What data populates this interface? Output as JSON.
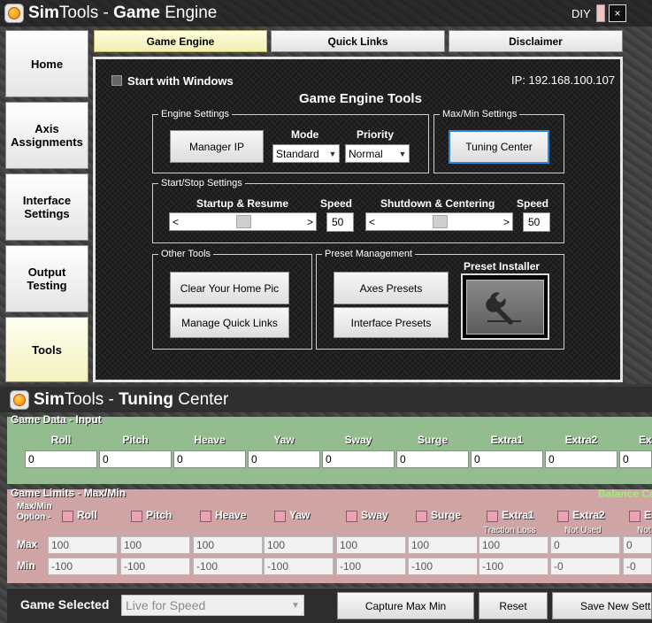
{
  "top_window": {
    "title_brand": "Sim",
    "title_brand_rest": "Tools - ",
    "title_bold": "Game",
    "title_rest": " Engine",
    "diy_label": "DIY",
    "close_glyph": "×",
    "logo_icon": "simtools-logo-icon",
    "sidebar": [
      {
        "label": "Home",
        "active": false
      },
      {
        "label": "Axis\nAssignments",
        "active": false
      },
      {
        "label": "Interface\nSettings",
        "active": false
      },
      {
        "label": "Output\nTesting",
        "active": false
      },
      {
        "label": "Tools",
        "active": true
      }
    ],
    "tabs": [
      {
        "label": "Game Engine",
        "active": true
      },
      {
        "label": "Quick Links",
        "active": false
      },
      {
        "label": "Disclaimer",
        "active": false
      }
    ],
    "tools": {
      "start_with_windows": "Start with Windows",
      "ip_label": "IP: 192.168.100.107",
      "heading": "Game Engine Tools",
      "engine_settings": {
        "title": "Engine Settings",
        "manager_ip_button": "Manager IP",
        "mode_label": "Mode",
        "mode_value": "Standard",
        "priority_label": "Priority",
        "priority_value": "Normal"
      },
      "maxmin_settings": {
        "title": "Max/Min Settings",
        "tuning_center_button": "Tuning Center"
      },
      "startstop_settings": {
        "title": "Start/Stop Settings",
        "startup_label": "Startup & Resume",
        "speed_label": "Speed",
        "startup_speed": "50",
        "shutdown_label": "Shutdown & Centering",
        "shutdown_speed": "50",
        "scroll_left": "<",
        "scroll_right": ">"
      },
      "other_tools": {
        "title": "Other Tools",
        "clear_home_pic": "Clear Your Home Pic",
        "manage_quick_links": "Manage Quick Links"
      },
      "preset_management": {
        "title": "Preset Management",
        "axes_presets": "Axes Presets",
        "interface_presets": "Interface Presets",
        "preset_installer_label": "Preset Installer",
        "preset_installer_icon": "wrench-icon"
      }
    }
  },
  "bottom_window": {
    "title_brand": "Sim",
    "title_brand_rest": "Tools - ",
    "title_bold": "Tuning",
    "title_rest": " Center",
    "game_data": {
      "title": "Game Data - Input",
      "columns": [
        "Roll",
        "Pitch",
        "Heave",
        "Yaw",
        "Sway",
        "Surge",
        "Extra1",
        "Extra2",
        "Ex"
      ],
      "values": [
        "0",
        "0",
        "0",
        "0",
        "0",
        "0",
        "0",
        "0",
        "0"
      ]
    },
    "game_limits": {
      "title": "Game Limits - Max/Min",
      "balance_label": "Balance Ca",
      "option_label_line1": "Max/Min",
      "option_label_line2": "Option -",
      "columns": [
        "Roll",
        "Pitch",
        "Heave",
        "Yaw",
        "Sway",
        "Surge",
        "Extra1",
        "Extra2",
        "E"
      ],
      "notes": [
        "",
        "",
        "",
        "",
        "",
        "",
        "Traction Loss",
        "Not Used",
        "Not"
      ],
      "max_label": "Max",
      "min_label": "Min",
      "max_values": [
        "100",
        "100",
        "100",
        "100",
        "100",
        "100",
        "100",
        "0",
        "0"
      ],
      "min_values": [
        "-100",
        "-100",
        "-100",
        "-100",
        "-100",
        "-100",
        "-100",
        "-0",
        "-0"
      ]
    },
    "footer": {
      "game_selected_label": "Game Selected",
      "game_selected_value": "Live for Speed",
      "capture_button": "Capture Max Min",
      "reset_button": "Reset",
      "save_button": "Save New Setting"
    }
  },
  "colors": {
    "game_data_bg": "#93bd8e",
    "game_limits_bg": "#cfa4a4",
    "balance_label": "#9cf07a",
    "focus_border": "#2a86d9",
    "active_tab": "#f1f0b0"
  }
}
